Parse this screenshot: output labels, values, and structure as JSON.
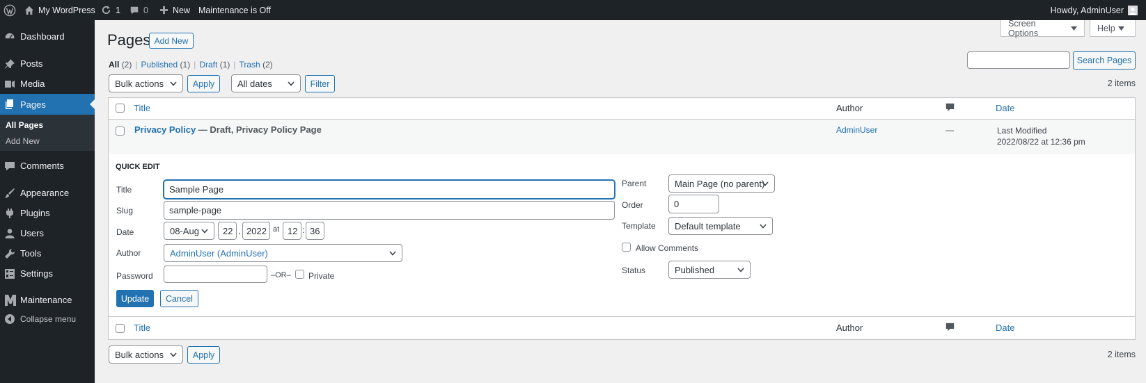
{
  "admin_bar": {
    "site_name": "My WordPress",
    "updates_count": "1",
    "comments_count": "0",
    "new_label": "New",
    "maintenance_status": "Maintenance is Off",
    "greeting": "Howdy, AdminUser"
  },
  "sidebar": {
    "items": [
      {
        "label": "Dashboard",
        "icon": "dashboard-icon"
      },
      {
        "label": "Posts",
        "icon": "pin-icon"
      },
      {
        "label": "Media",
        "icon": "media-icon"
      },
      {
        "label": "Pages",
        "icon": "pages-icon"
      },
      {
        "label": "Comments",
        "icon": "comment-icon"
      },
      {
        "label": "Appearance",
        "icon": "brush-icon"
      },
      {
        "label": "Plugins",
        "icon": "plugin-icon"
      },
      {
        "label": "Users",
        "icon": "user-icon"
      },
      {
        "label": "Tools",
        "icon": "wrench-icon"
      },
      {
        "label": "Settings",
        "icon": "settings-icon"
      },
      {
        "label": "Maintenance",
        "icon": "maintenance-icon"
      },
      {
        "label": "Collapse menu",
        "icon": "collapse-icon"
      }
    ],
    "submenu": [
      "All Pages",
      "Add New"
    ]
  },
  "header": {
    "title": "Pages",
    "add_new": "Add New",
    "screen_options": "Screen Options",
    "help": "Help"
  },
  "filters": {
    "all": "All",
    "all_count": "(2)",
    "published": "Published",
    "published_count": "(1)",
    "draft": "Draft",
    "draft_count": "(1)",
    "trash": "Trash",
    "trash_count": "(2)",
    "separator": "|"
  },
  "search": {
    "value": "",
    "button": "Search Pages"
  },
  "toolbar": {
    "bulk_actions": "Bulk actions",
    "apply": "Apply",
    "all_dates": "All dates",
    "filter": "Filter",
    "items_count": "2 items"
  },
  "table": {
    "col_title": "Title",
    "col_author": "Author",
    "col_date": "Date",
    "comments_icon": "comment-bubble-icon",
    "rows": [
      {
        "title": "Privacy Policy",
        "state": "— Draft, Privacy Policy Page",
        "author": "AdminUser",
        "comments": "—",
        "date_label": "Last Modified",
        "date_value": "2022/08/22 at 12:36 pm"
      }
    ]
  },
  "quick_edit": {
    "heading": "QUICK EDIT",
    "title_label": "Title",
    "title_value": "Sample Page",
    "slug_label": "Slug",
    "slug_value": "sample-page",
    "date_label": "Date",
    "month": "08-Aug",
    "day": "22",
    "comma": ",",
    "year": "2022",
    "at": "at",
    "hour": "12",
    "colon": ":",
    "minute": "36",
    "author_label": "Author",
    "author_value": "AdminUser (AdminUser)",
    "password_label": "Password",
    "password_value": "",
    "or_label": "–OR–",
    "private_label": "Private",
    "parent_label": "Parent",
    "parent_value": "Main Page (no parent)",
    "order_label": "Order",
    "order_value": "0",
    "template_label": "Template",
    "template_value": "Default template",
    "allow_comments": "Allow Comments",
    "status_label": "Status",
    "status_value": "Published",
    "update": "Update",
    "cancel": "Cancel"
  },
  "colors": {
    "admin_bar": "#1d2327",
    "accent": "#2271b1",
    "background": "#f0f0f1"
  }
}
